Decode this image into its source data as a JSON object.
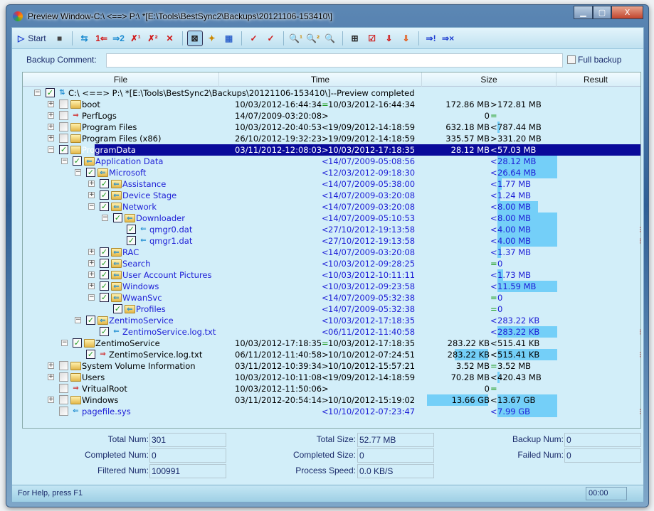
{
  "window": {
    "title": "Preview Window-C:\\ <==> P:\\ *[E:\\Tools\\BestSync2\\Backups\\20121106-153410\\]",
    "minimize": "▁",
    "maximize": "▢",
    "close": "X"
  },
  "toolbar": {
    "start_label": "Start",
    "items": [
      {
        "icon": "start-icon",
        "glyph": "▷",
        "color": "#1a3ad0"
      },
      {
        "icon": "stop-icon",
        "glyph": "■",
        "color": "#444"
      },
      {
        "sep": true
      },
      {
        "icon": "sync-both-icon",
        "glyph": "⇆",
        "color": "#1a8ad0"
      },
      {
        "icon": "sync-to-1-icon",
        "glyph": "1⇐",
        "color": "#d01a1a"
      },
      {
        "icon": "sync-to-2-icon",
        "glyph": "⇒2",
        "color": "#1a8ad0"
      },
      {
        "icon": "delete-1-icon",
        "glyph": "✗¹",
        "color": "#d01a1a"
      },
      {
        "icon": "delete-2-icon",
        "glyph": "✗²",
        "color": "#d01a1a"
      },
      {
        "icon": "delete-icon",
        "glyph": "✕",
        "color": "#d01a1a"
      },
      {
        "sep": true
      },
      {
        "icon": "preview-icon",
        "glyph": "⊠",
        "color": "#222",
        "active": true
      },
      {
        "icon": "preview-new-icon",
        "glyph": "✦",
        "color": "#c80"
      },
      {
        "icon": "preview-all-icon",
        "glyph": "▦",
        "color": "#36c"
      },
      {
        "sep": true
      },
      {
        "icon": "check-icon",
        "glyph": "✓",
        "color": "#d01a1a"
      },
      {
        "icon": "uncheck-icon",
        "glyph": "✓",
        "color": "#d01a1a"
      },
      {
        "sep": true
      },
      {
        "icon": "find-1-icon",
        "glyph": "🔍¹",
        "color": "#c80"
      },
      {
        "icon": "find-2-icon",
        "glyph": "🔍²",
        "color": "#c80"
      },
      {
        "icon": "find-file-icon",
        "glyph": "🔍",
        "color": "#333"
      },
      {
        "sep": true
      },
      {
        "icon": "tree-icon",
        "glyph": "⊞",
        "color": "#222"
      },
      {
        "icon": "select-all-icon",
        "glyph": "☑",
        "color": "#d01a1a"
      },
      {
        "icon": "move-down-icon",
        "glyph": "⇓",
        "color": "#d01a1a"
      },
      {
        "icon": "move-down-file-icon",
        "glyph": "⇓",
        "color": "#e35a1a"
      },
      {
        "sep": true
      },
      {
        "icon": "next-error-icon",
        "glyph": "⇒!",
        "color": "#1a3ad0"
      },
      {
        "icon": "next-skip-icon",
        "glyph": "⇒×",
        "color": "#1a3ad0"
      }
    ]
  },
  "comment": {
    "label": "Backup Comment:",
    "value": "",
    "full_backup_label": "Full backup",
    "full_backup_checked": false
  },
  "columns": {
    "file": "File",
    "time": "Time",
    "size": "Size",
    "result": "Result"
  },
  "rows": [
    {
      "name": "C:\\ <==> P:\\ *[E:\\Tools\\BestSync2\\Backups\\20121106-153410\\]--Preview completed",
      "level": 0,
      "exp": "minus",
      "checked": true,
      "icon": "sync-root",
      "color": "black"
    },
    {
      "name": "boot",
      "level": 1,
      "exp": "plus",
      "checked": false,
      "icon": "folder",
      "color": "black",
      "ltime": "10/03/2012-16:44:34",
      "tcmp": "=",
      "rtime": "10/03/2012-16:44:34",
      "lsize": "172.86 MB",
      "scmp": ">",
      "rsize": "172.81 MB"
    },
    {
      "name": "PerfLogs",
      "level": 1,
      "exp": "plus",
      "checked": false,
      "icon": "newer-2",
      "color": "black",
      "ltime": "14/07/2009-03:20:08",
      "tcmp": ">",
      "rtime": "",
      "lsize": "0",
      "scmp": "=",
      "rsize": ""
    },
    {
      "name": "Program Files",
      "level": 1,
      "exp": "plus",
      "checked": false,
      "icon": "folder",
      "color": "black",
      "ltime": "10/03/2012-20:40:53",
      "tcmp": "<",
      "rtime": "19/09/2012-14:18:59",
      "lsize": "632.18 MB",
      "scmp": "<",
      "rsize": "787.44 MB",
      "rbar": 0.04
    },
    {
      "name": "Program Files (x86)",
      "level": 1,
      "exp": "plus",
      "checked": false,
      "icon": "folder",
      "color": "black",
      "ltime": "26/10/2012-19:32:23",
      "tcmp": ">",
      "rtime": "19/09/2012-14:18:59",
      "lsize": "335.57 MB",
      "scmp": ">",
      "rsize": "331.20 MB"
    },
    {
      "name": "ProgramData",
      "level": 1,
      "exp": "minus",
      "checked": true,
      "icon": "folder",
      "color": "black",
      "selected": true,
      "ltime": "03/11/2012-12:08:03",
      "tcmp": ">",
      "rtime": "10/03/2012-17:18:35",
      "lsize": "28.12 MB",
      "scmp": "<",
      "rsize": "57.03 MB"
    },
    {
      "name": "Application Data",
      "level": 2,
      "exp": "minus",
      "checked": true,
      "icon": "folder-to-1",
      "color": "blue",
      "tcmp": "<",
      "rtime": "14/07/2009-05:08:56",
      "scmp": "<",
      "rsize": "28.12 MB",
      "rbar": 1
    },
    {
      "name": "Microsoft",
      "level": 3,
      "exp": "minus",
      "checked": true,
      "icon": "folder-to-1",
      "color": "blue",
      "tcmp": "<",
      "rtime": "12/03/2012-09:18:30",
      "scmp": "<",
      "rsize": "26.64 MB",
      "rbar": 1
    },
    {
      "name": "Assistance",
      "level": 4,
      "exp": "plus",
      "checked": true,
      "icon": "folder-to-1",
      "color": "blue",
      "tcmp": "<",
      "rtime": "14/07/2009-05:38:00",
      "scmp": "<",
      "rsize": "1.77 MB",
      "rbar": 0.07
    },
    {
      "name": "Device Stage",
      "level": 4,
      "exp": "plus",
      "checked": true,
      "icon": "folder-to-1",
      "color": "blue",
      "tcmp": "<",
      "rtime": "14/07/2009-03:20:08",
      "scmp": "<",
      "rsize": "1.24 MB",
      "rbar": 0.05
    },
    {
      "name": "Network",
      "level": 4,
      "exp": "minus",
      "checked": true,
      "icon": "folder-to-1",
      "color": "blue",
      "tcmp": "<",
      "rtime": "14/07/2009-03:20:08",
      "scmp": "<",
      "rsize": "8.00 MB",
      "rbar": 0.68
    },
    {
      "name": "Downloader",
      "level": 5,
      "exp": "minus",
      "checked": true,
      "icon": "folder-to-1",
      "color": "blue",
      "tcmp": "<",
      "rtime": "14/07/2009-05:10:53",
      "scmp": "<",
      "rsize": "8.00 MB",
      "rbar": 1
    },
    {
      "name": "qmgr0.dat",
      "level": 6,
      "exp": "",
      "checked": true,
      "icon": "file-to-1",
      "color": "blue",
      "tcmp": "<",
      "rtime": "27/10/2012-19:13:58",
      "scmp": "<",
      "rsize": "4.00 MB",
      "rbar": 1,
      "result": "⁝"
    },
    {
      "name": "qmgr1.dat",
      "level": 6,
      "exp": "",
      "checked": true,
      "icon": "file-to-1",
      "color": "blue",
      "tcmp": "<",
      "rtime": "27/10/2012-19:13:58",
      "scmp": "<",
      "rsize": "4.00 MB",
      "rbar": 1,
      "result": "⁝"
    },
    {
      "name": "RAC",
      "level": 4,
      "exp": "plus",
      "checked": true,
      "icon": "folder-to-1",
      "color": "blue",
      "tcmp": "<",
      "rtime": "14/07/2009-03:20:08",
      "scmp": "<",
      "rsize": "1.37 MB",
      "rbar": 0.06
    },
    {
      "name": "Search",
      "level": 4,
      "exp": "plus",
      "checked": true,
      "icon": "folder-to-1",
      "color": "blue",
      "tcmp": "<",
      "rtime": "10/03/2012-09:28:25",
      "scmp": "=",
      "rsize": "0"
    },
    {
      "name": "User Account Pictures",
      "level": 4,
      "exp": "plus",
      "checked": true,
      "icon": "folder-to-1",
      "color": "blue",
      "tcmp": "<",
      "rtime": "10/03/2012-10:11:11",
      "scmp": "<",
      "rsize": "1.73 MB",
      "rbar": 0.1
    },
    {
      "name": "Windows",
      "level": 4,
      "exp": "plus",
      "checked": true,
      "icon": "folder-to-1",
      "color": "blue",
      "tcmp": "<",
      "rtime": "10/03/2012-09:23:58",
      "scmp": "<",
      "rsize": "11.59 MB",
      "rbar": 1
    },
    {
      "name": "WwanSvc",
      "level": 4,
      "exp": "minus",
      "checked": true,
      "icon": "folder-to-1",
      "color": "blue",
      "tcmp": "<",
      "rtime": "14/07/2009-05:32:38",
      "scmp": "=",
      "rsize": "0"
    },
    {
      "name": "Profiles",
      "level": 5,
      "exp": "",
      "checked": true,
      "icon": "folder-to-1",
      "color": "blue",
      "tcmp": "<",
      "rtime": "14/07/2009-05:32:38",
      "scmp": "=",
      "rsize": "0"
    },
    {
      "name": "ZentimoService",
      "level": 3,
      "exp": "minus",
      "checked": true,
      "icon": "folder-to-1",
      "color": "blue",
      "tcmp": "<",
      "rtime": "10/03/2012-17:18:35",
      "scmp": "<",
      "rsize": "283.22 KB"
    },
    {
      "name": "ZentimoService.log.txt",
      "level": 4,
      "exp": "",
      "checked": true,
      "icon": "file-to-1",
      "color": "blue",
      "tcmp": "<",
      "rtime": "06/11/2012-11:40:58",
      "scmp": "<",
      "rsize": "283.22 KB",
      "rbar": 1,
      "result": "⁝"
    },
    {
      "name": "ZentimoService",
      "level": 2,
      "exp": "minus",
      "checked": true,
      "icon": "folder",
      "color": "black",
      "ltime": "10/03/2012-17:18:35",
      "tcmp": "=",
      "rtime": "10/03/2012-17:18:35",
      "lsize": "283.22 KB",
      "scmp": "<",
      "rsize": "515.41 KB"
    },
    {
      "name": "ZentimoService.log.txt",
      "level": 3,
      "exp": "",
      "checked": true,
      "icon": "file-to-2",
      "color": "black",
      "ltime": "06/11/2012-11:40:58",
      "tcmp": ">",
      "rtime": "10/10/2012-07:24:51",
      "lsize": "283.22 KB",
      "lbar": 0.55,
      "scmp": "<",
      "rsize": "515.41 KB",
      "rbar": 1,
      "result": "⁝"
    },
    {
      "name": "System Volume Information",
      "level": 1,
      "exp": "plus",
      "checked": false,
      "icon": "folder",
      "color": "black",
      "ltime": "03/11/2012-10:39:34",
      "tcmp": ">",
      "rtime": "10/10/2012-15:57:21",
      "lsize": "3.52 MB",
      "scmp": "=",
      "rsize": "3.52 MB"
    },
    {
      "name": "Users",
      "level": 1,
      "exp": "plus",
      "checked": false,
      "icon": "folder",
      "color": "black",
      "ltime": "10/03/2012-10:11:08",
      "tcmp": "<",
      "rtime": "19/09/2012-14:18:59",
      "lsize": "70.28 MB",
      "scmp": "<",
      "rsize": "420.43 MB",
      "rbar": 0.03
    },
    {
      "name": "VritualRoot",
      "level": 1,
      "exp": "",
      "checked": false,
      "icon": "newer-2",
      "color": "black",
      "ltime": "10/03/2012-11:50:06",
      "tcmp": ">",
      "rtime": "",
      "lsize": "0",
      "scmp": "=",
      "rsize": ""
    },
    {
      "name": "Windows",
      "level": 1,
      "exp": "plus",
      "checked": false,
      "icon": "folder",
      "color": "black",
      "ltime": "03/11/2012-20:54:14",
      "tcmp": ">",
      "rtime": "10/10/2012-15:19:02",
      "lsize": "13.66 GB",
      "lbar": 1,
      "scmp": "<",
      "rsize": "13.67 GB",
      "rbar": 1
    },
    {
      "name": "pagefile.sys",
      "level": 1,
      "exp": "",
      "checked": false,
      "icon": "file-to-1",
      "color": "blue",
      "tcmp": "<",
      "rtime": "10/10/2012-07:23:47",
      "scmp": "<",
      "rsize": "7.99 GB",
      "rbar": 1,
      "result": "⁝"
    }
  ],
  "stats": {
    "total_num_label": "Total Num:",
    "total_num": "301",
    "completed_num_label": "Completed Num:",
    "completed_num": "0",
    "filtered_num_label": "Filtered Num:",
    "filtered_num": "100991",
    "total_size_label": "Total Size:",
    "total_size": "52.77 MB",
    "completed_size_label": "Completed Size:",
    "completed_size": "0",
    "process_speed_label": "Process Speed:",
    "process_speed": "0.0 KB/S",
    "backup_num_label": "Backup Num:",
    "backup_num": "0",
    "failed_num_label": "Failed Num:",
    "failed_num": "0"
  },
  "status": {
    "help": "For Help, press F1",
    "time": "00:00"
  },
  "colors": {
    "selected": "#0a0a9a",
    "size_bar": "#74cff8",
    "blue_text": "#1d1dd6",
    "equal": "#1a9a1a"
  }
}
